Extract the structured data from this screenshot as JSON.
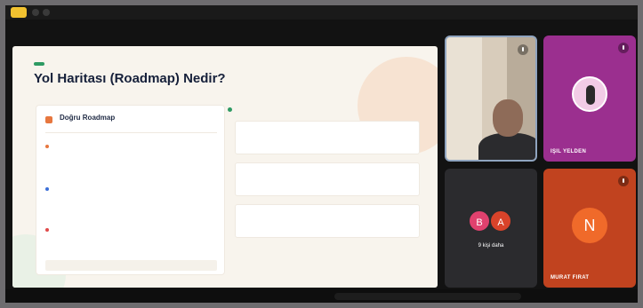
{
  "slide": {
    "badge": "",
    "title": "Yol Haritası (Roadmap) Nedir?",
    "subtitle": "",
    "left_card": {
      "title": "Doğru Roadmap",
      "subtitle": "",
      "items": [
        {
          "title": "",
          "text": ""
        },
        {
          "title": "",
          "text": ""
        },
        {
          "title": "",
          "text": ""
        }
      ],
      "footer": ""
    },
    "right_section": {
      "title": "",
      "cards": [
        {
          "time": "",
          "tag": "",
          "l1": "",
          "l2": "",
          "r1": "",
          "r2": ""
        },
        {
          "time": "",
          "tag": "",
          "l1": "",
          "l2": "",
          "r1": "",
          "r2": ""
        },
        {
          "time": "",
          "tag": "",
          "l1": "",
          "l2": "",
          "r1": "",
          "r2": ""
        }
      ]
    }
  },
  "participants": {
    "video": {
      "name": ""
    },
    "isil": {
      "name": "IŞIL YELDEN"
    },
    "more": {
      "label": "9 kişi daha",
      "avatars": [
        "B",
        "A"
      ],
      "colors": [
        "#e0416e",
        "#d9432a"
      ]
    },
    "murat": {
      "initial": "N",
      "name": "MURAT FIRAT"
    }
  },
  "colors": {
    "accent_green": "#2e9a63",
    "isil_bg": "#9b2f8f",
    "murat_bg": "#c1431f"
  }
}
